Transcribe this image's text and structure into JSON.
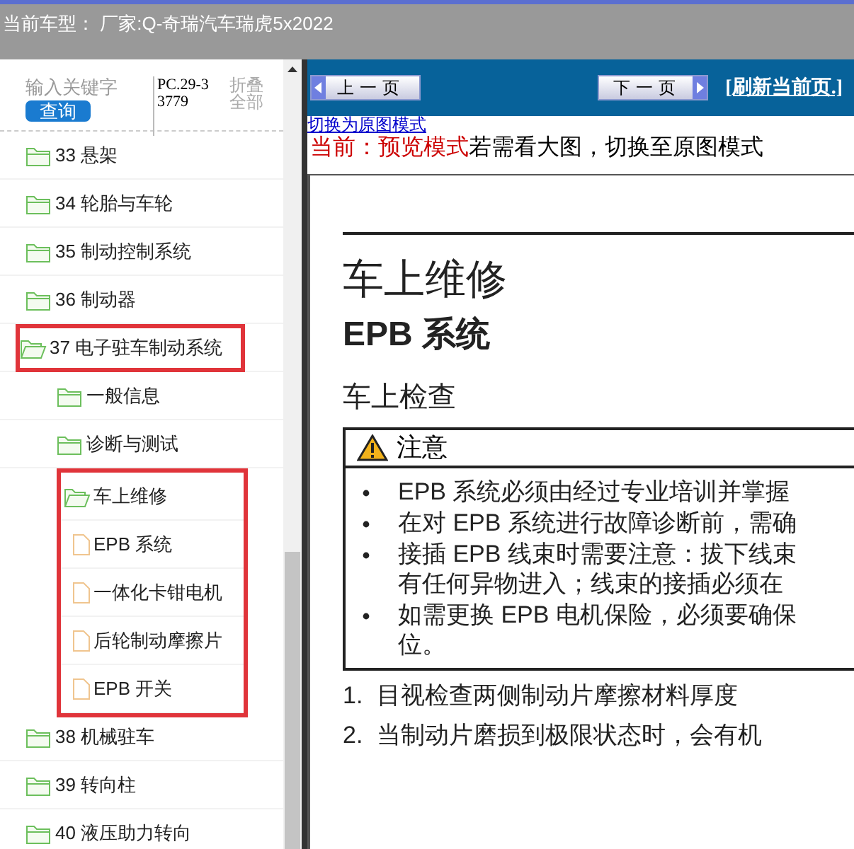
{
  "title_bar": {
    "text": "当前车型： 厂家:Q-奇瑞汽车瑞虎5x2022"
  },
  "sidebar": {
    "search": {
      "placeholder": "输入关键字"
    },
    "search_button": "查询",
    "code": "PC.29-33779",
    "collapse_all": "折叠全部",
    "tree": [
      {
        "label": "33 悬架",
        "kind": "folder",
        "highlighted": false
      },
      {
        "label": "34 轮胎与车轮",
        "kind": "folder",
        "highlighted": false
      },
      {
        "label": "35 制动控制系统",
        "kind": "folder",
        "highlighted": false
      },
      {
        "label": "36 制动器",
        "kind": "folder",
        "highlighted": false
      },
      {
        "label": "37 电子驻车制动系统",
        "kind": "folder",
        "expanded": true,
        "highlighted": true,
        "children": [
          {
            "label": "一般信息",
            "kind": "folder",
            "highlighted": false
          },
          {
            "label": "诊断与测试",
            "kind": "folder",
            "highlighted": false
          },
          {
            "label": "车上维修",
            "kind": "folder",
            "expanded": true,
            "highlighted": true,
            "children": [
              {
                "label": "EPB 系统",
                "kind": "page",
                "highlighted": false
              },
              {
                "label": "一体化卡钳电机",
                "kind": "page",
                "highlighted": false
              },
              {
                "label": "后轮制动摩擦片",
                "kind": "page",
                "highlighted": false
              },
              {
                "label": "EPB 开关",
                "kind": "page",
                "highlighted": false
              }
            ]
          }
        ]
      },
      {
        "label": "38 机械驻车",
        "kind": "folder",
        "highlighted": false
      },
      {
        "label": "39 转向柱",
        "kind": "folder",
        "highlighted": false
      },
      {
        "label": "40 液压助力转向",
        "kind": "folder",
        "highlighted": false
      }
    ]
  },
  "toolbar": {
    "prev": "上一页",
    "next": "下一页",
    "refresh": "[刷新当前页.]"
  },
  "mode": {
    "switch_link": "切换为原图模式",
    "current_label": "当前：预览模式",
    "hint": "若需看大图，切换至原图模式"
  },
  "document": {
    "title": "车上维修",
    "subtitle": "EPB 系统",
    "section": "车上检查",
    "notice": {
      "title": "注意",
      "bullets": [
        "EPB 系统必须由经过专业培训并掌握",
        "在对 EPB 系统进行故障诊断前，需确",
        "接插 EPB 线束时需要注意：拔下线束有任何异物进入；线束的接插必须在",
        "如需更换 EPB 电机保险，必须要确保位。"
      ]
    },
    "steps": [
      {
        "number": "1.",
        "text": "目视检查两侧制动片摩擦材料厚度"
      },
      {
        "number": "2.",
        "text": "当制动片磨损到极限状态时，会有机"
      }
    ]
  }
}
